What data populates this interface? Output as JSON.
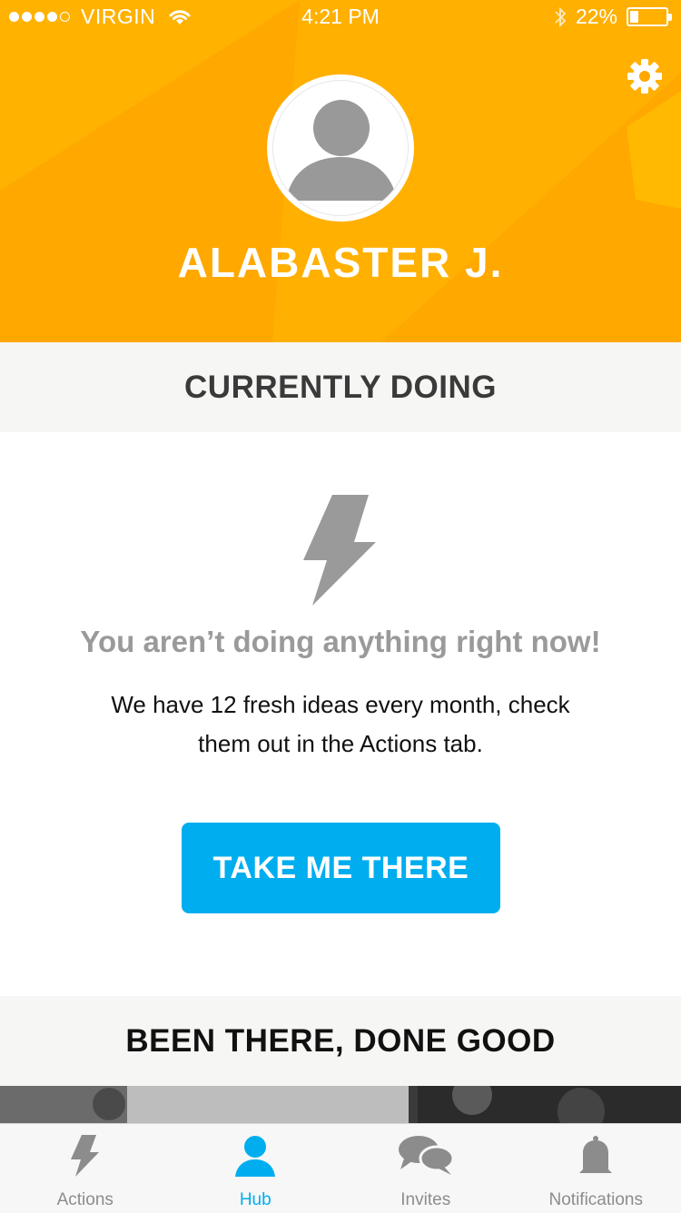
{
  "status_bar": {
    "carrier": "VIRGIN",
    "time": "4:21 PM",
    "battery": "22%"
  },
  "profile": {
    "name": "ALABASTER J."
  },
  "currently_doing": {
    "title": "CURRENTLY DOING",
    "empty_title": "You aren’t doing anything right now!",
    "empty_desc": "We have 12 fresh ideas every month, check them out in the Actions tab.",
    "cta_label": "TAKE ME THERE"
  },
  "been_there": {
    "title": "BEEN THERE, DONE GOOD"
  },
  "tabbar": {
    "tabs": [
      {
        "label": "Actions",
        "icon": "bolt-icon",
        "active": false
      },
      {
        "label": "Hub",
        "icon": "person-icon",
        "active": true
      },
      {
        "label": "Invites",
        "icon": "chat-bubbles-icon",
        "active": false
      },
      {
        "label": "Notifications",
        "icon": "bell-icon",
        "active": false
      }
    ]
  },
  "colors": {
    "header": "#FFA800",
    "accent": "#00AEEF",
    "icon_gray": "#9a9a9a"
  }
}
